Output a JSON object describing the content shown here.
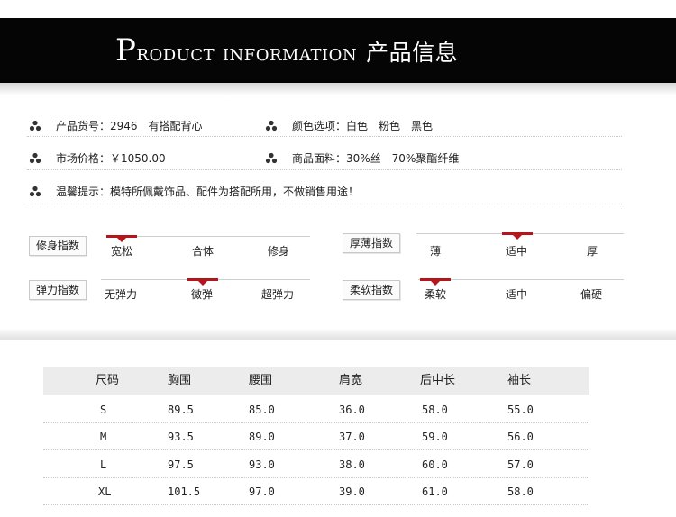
{
  "banner": {
    "title_p": "P",
    "title_roduct": "roduct",
    "title_information": "information",
    "title_cn": "产品信息"
  },
  "info": {
    "product_no": "产品货号：2946　有搭配背心",
    "colors": "颜色选项：白色　粉色　黑色",
    "price": "市场价格：￥1050.00",
    "fabric": "商品面料：30%丝　70%聚酯纤维",
    "tip": "温馨提示：模特所佩戴饰品、配件为搭配所用，不做销售用途！"
  },
  "scales": {
    "fit": {
      "label": "修身指数",
      "options": [
        "宽松",
        "合体",
        "修身"
      ],
      "selected": 0
    },
    "thickness": {
      "label": "厚薄指数",
      "options": [
        "薄",
        "适中",
        "厚"
      ],
      "selected": 1
    },
    "elasticity": {
      "label": "弹力指数",
      "options": [
        "无弹力",
        "微弹",
        "超弹力"
      ],
      "selected": 1
    },
    "softness": {
      "label": "柔软指数",
      "options": [
        "柔软",
        "适中",
        "偏硬"
      ],
      "selected": 0
    }
  },
  "size_table": {
    "headers": [
      "尺码",
      "胸围",
      "腰围",
      "肩宽",
      "后中长",
      "袖长"
    ],
    "rows": [
      [
        "S",
        "89.5",
        "85.0",
        "36.0",
        "58.0",
        "55.0"
      ],
      [
        "M",
        "93.5",
        "89.0",
        "37.0",
        "59.0",
        "56.0"
      ],
      [
        "L",
        "97.5",
        "93.0",
        "38.0",
        "60.0",
        "57.0"
      ],
      [
        "XL",
        "101.5",
        "97.0",
        "39.0",
        "61.0",
        "58.0"
      ]
    ]
  },
  "colors": {
    "banner_bg": "#050505",
    "marker": "#b5161c",
    "table_header_bg": "#ececec"
  }
}
